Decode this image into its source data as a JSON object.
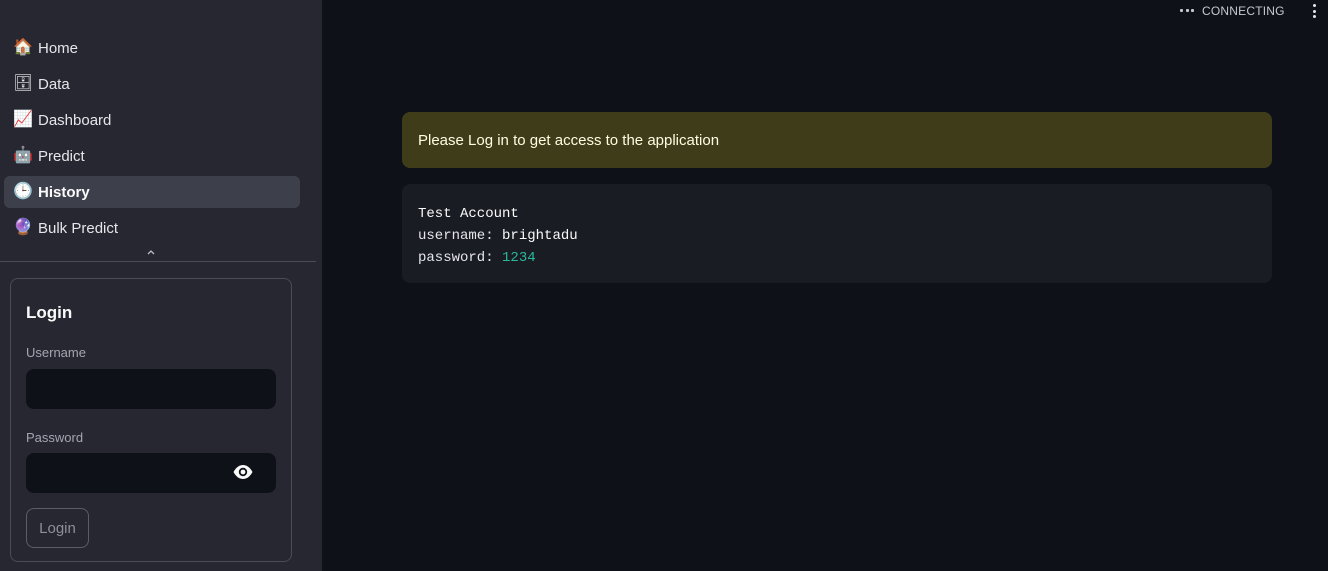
{
  "sidebar": {
    "nav": [
      {
        "icon": "house-icon",
        "glyph": "🏠",
        "label": "Home",
        "active": false
      },
      {
        "icon": "database-icon",
        "glyph": "🗄",
        "label": "Data",
        "active": false
      },
      {
        "icon": "chart-increasing-icon",
        "glyph": "📈",
        "label": "Dashboard",
        "active": false
      },
      {
        "icon": "robot-icon",
        "glyph": "🤖",
        "label": "Predict",
        "active": false
      },
      {
        "icon": "clock-icon",
        "glyph": "🕒",
        "label": "History",
        "active": true
      },
      {
        "icon": "crystal-ball-icon",
        "glyph": "🔮",
        "label": "Bulk Predict",
        "active": false
      }
    ],
    "login": {
      "title": "Login",
      "username_label": "Username",
      "username_value": "",
      "password_label": "Password",
      "password_value": "",
      "button_label": "Login"
    }
  },
  "topbar": {
    "status": "CONNECTING"
  },
  "main": {
    "warning": "Please Log in to get access to the application",
    "code": {
      "line1": "Test Account",
      "line2_key": "username:",
      "line2_value": "brightadu",
      "line3_key": "password:",
      "line3_value": "1234"
    }
  },
  "colors": {
    "app_bg": "#0e1117",
    "sidebar_bg": "#262730",
    "active_nav_bg": "#3d3f4b",
    "warning_bg": "#3f3c19",
    "warning_text": "#fffce3",
    "code_bg": "#1a1c24",
    "code_number": "#28b89a"
  }
}
